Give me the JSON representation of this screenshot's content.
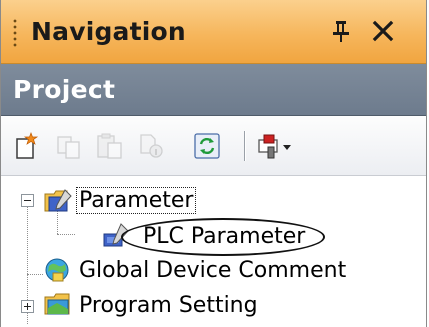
{
  "titlebar": {
    "title": "Navigation",
    "pin_icon": "pin-icon",
    "close_icon": "close-icon",
    "colors": {
      "top": "#fbd08d",
      "bottom": "#f1a540"
    }
  },
  "project": {
    "title": "Project",
    "color": "#75828f"
  },
  "toolbar": {
    "buttons": [
      {
        "name": "new-data-icon",
        "enabled": true
      },
      {
        "name": "copy-icon",
        "enabled": false
      },
      {
        "name": "paste-icon",
        "enabled": false
      },
      {
        "name": "properties-icon",
        "enabled": false
      },
      {
        "name": "refresh-icon",
        "enabled": true
      },
      {
        "name": "tool-dropdown-icon",
        "enabled": true
      }
    ]
  },
  "tree": {
    "items": [
      {
        "label": "Parameter",
        "icon": "parameter-folder-icon",
        "expander": "collapse",
        "level": 0,
        "focused": true
      },
      {
        "label": "PLC Parameter",
        "icon": "plc-parameter-icon",
        "level": 1,
        "highlighted": true
      },
      {
        "label": "Global Device Comment",
        "icon": "global-device-comment-icon",
        "level": 0
      },
      {
        "label": "Program Setting",
        "icon": "program-setting-folder-icon",
        "expander": "expand",
        "level": 0
      }
    ]
  }
}
